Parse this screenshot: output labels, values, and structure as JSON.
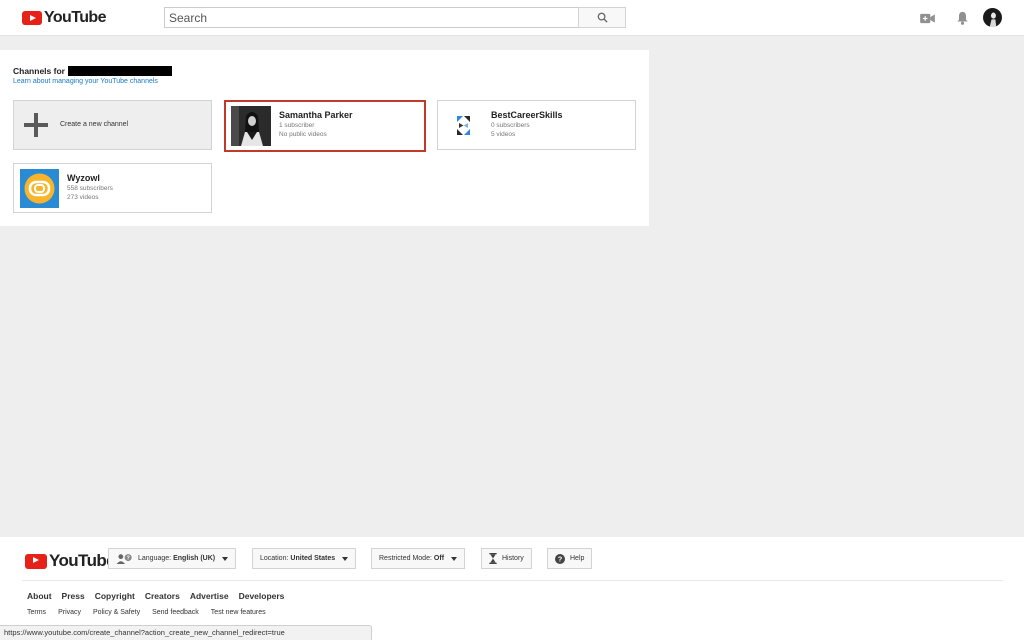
{
  "header": {
    "logo_text": "YouTube",
    "search_placeholder": "Search",
    "icons": [
      "youtube-logo-icon",
      "search-icon",
      "upload-video-icon",
      "bell-icon",
      "avatar"
    ]
  },
  "panel": {
    "title": "Channels for",
    "manage_link": "Learn about managing your YouTube channels",
    "create_label": "Create a new channel",
    "channels": [
      {
        "name": "Samantha Parker",
        "subscribers": "1 subscriber",
        "videos": "No public videos"
      },
      {
        "name": "BestCareerSkills",
        "subscribers": "0 subscribers",
        "videos": "5 videos"
      },
      {
        "name": "Wyzowl",
        "subscribers": "558 subscribers",
        "videos": "273 videos"
      }
    ]
  },
  "footer": {
    "logo_text": "YouTube",
    "language_label": "Language:",
    "language_value": "English (UK)",
    "location_label": "Location:",
    "location_value": "United States",
    "restricted_label": "Restricted Mode:",
    "restricted_value": "Off",
    "history_label": "History",
    "help_label": "Help",
    "primary_links": [
      "About",
      "Press",
      "Copyright",
      "Creators",
      "Advertise",
      "Developers"
    ],
    "secondary_links": [
      "Terms",
      "Privacy",
      "Policy & Safety",
      "Send feedback",
      "Test new features"
    ]
  },
  "status_url": "https://www.youtube.com/create_channel?action_create_new_channel_redirect=true",
  "colors": {
    "brand_red": "#e62117",
    "link_blue": "#167ac6",
    "selected_border": "#c0392b",
    "wyzowl_blue": "#2a8bd4",
    "wyzowl_yellow": "#f7b52b"
  }
}
